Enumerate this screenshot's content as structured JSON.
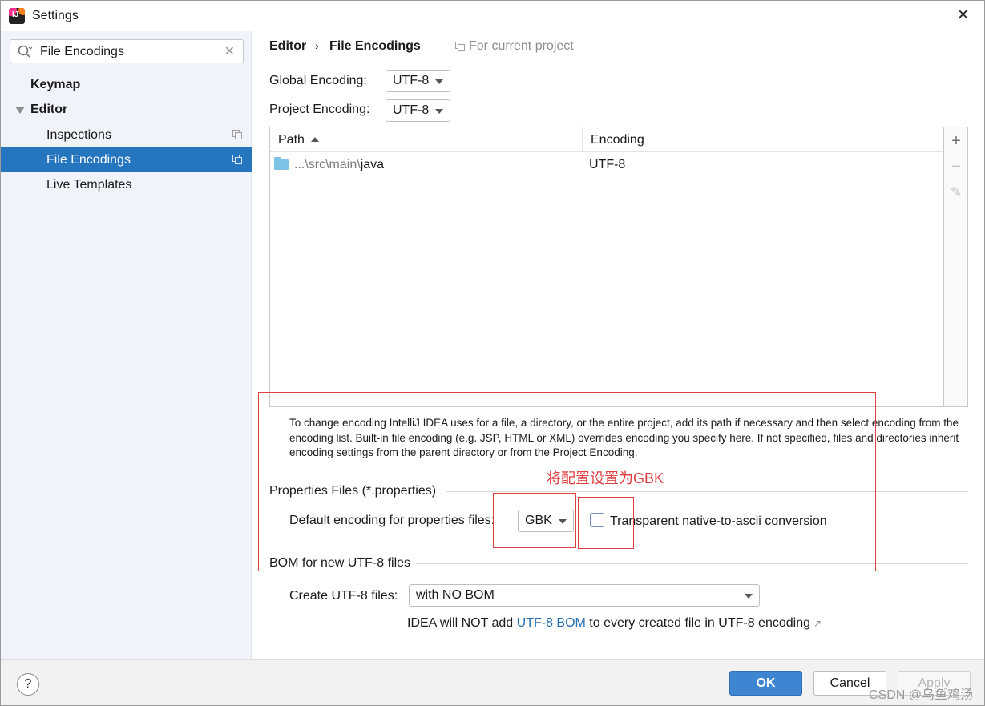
{
  "window": {
    "title": "Settings"
  },
  "search": {
    "value": "File Encodings"
  },
  "sidebar": {
    "items": [
      {
        "label": "Keymap"
      },
      {
        "label": "Editor"
      },
      {
        "label": "Inspections"
      },
      {
        "label": "File Encodings"
      },
      {
        "label": "Live Templates"
      }
    ]
  },
  "breadcrumb": {
    "parent": "Editor",
    "separator": "›",
    "current": "File Encodings",
    "scope": "For current project"
  },
  "global_encoding": {
    "label": "Global Encoding:",
    "value": "UTF-8"
  },
  "project_encoding": {
    "label": "Project Encoding:",
    "value": "UTF-8"
  },
  "table": {
    "columns": [
      "Path",
      "Encoding"
    ],
    "rows": [
      {
        "path_prefix": "...\\src\\main\\",
        "path_name": "java",
        "encoding": "UTF-8"
      }
    ]
  },
  "hint": "To change encoding IntelliJ IDEA uses for a file, a directory, or the entire project, add its path if necessary and then select encoding from the encoding list. Built-in file encoding (e.g. JSP, HTML or XML) overrides encoding you specify here. If not specified, files and directories inherit encoding settings from the parent directory or from the Project Encoding.",
  "annotation": "将配置设置为GBK",
  "properties": {
    "section_title": "Properties Files (*.properties)",
    "default_label": "Default encoding for properties files:",
    "default_value": "GBK",
    "transparent_label": "Transparent native-to-ascii conversion",
    "transparent_checked": false
  },
  "bom": {
    "section_title": "BOM for new UTF-8 files",
    "create_label": "Create UTF-8 files:",
    "create_value": "with NO BOM",
    "note_prefix": "IDEA will NOT add ",
    "note_link": "UTF-8 BOM",
    "note_suffix": " to every created file in UTF-8 encoding",
    "note_arrow": "↗"
  },
  "footer": {
    "help": "?",
    "ok": "OK",
    "cancel": "Cancel",
    "apply": "Apply",
    "watermark": "CSDN @乌鱼鸡汤"
  },
  "colors": {
    "accent": "#2675bf",
    "annotation_red": "#e24040",
    "link": "#2470b3",
    "sidebar_bg": "#f0f4fa"
  }
}
